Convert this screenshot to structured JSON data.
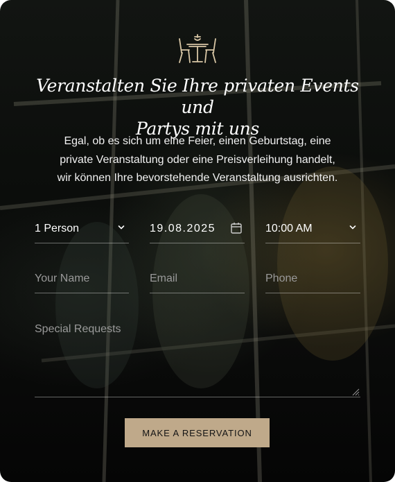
{
  "colors": {
    "accent": "#bfa98a",
    "icon_line": "#d9c7a6",
    "text": "#ffffff",
    "placeholder": "#9a9a9a"
  },
  "icon": {
    "name": "table-chairs-icon"
  },
  "heading": {
    "line1": "Veranstalten Sie Ihre privaten Events und",
    "line2": "Partys mit uns"
  },
  "description": {
    "line1": "Egal, ob es sich um eine Feier, einen Geburtstag, eine",
    "line2": "private Veranstaltung oder eine Preisverleihung handelt,",
    "line3": "wir können Ihre bevorstehende Veranstaltung ausrichten."
  },
  "form": {
    "guests": {
      "value": "1 Person",
      "icon": "chevron-down-icon"
    },
    "date": {
      "value": "19.08.2025",
      "icon": "calendar-icon"
    },
    "time": {
      "value": "10:00 AM",
      "icon": "chevron-down-icon"
    },
    "name": {
      "placeholder": "Your Name"
    },
    "email": {
      "placeholder": "Email"
    },
    "phone": {
      "placeholder": "Phone"
    },
    "requests": {
      "placeholder": "Special Requests"
    }
  },
  "button": {
    "label": "MAKE A RESERVATION"
  }
}
